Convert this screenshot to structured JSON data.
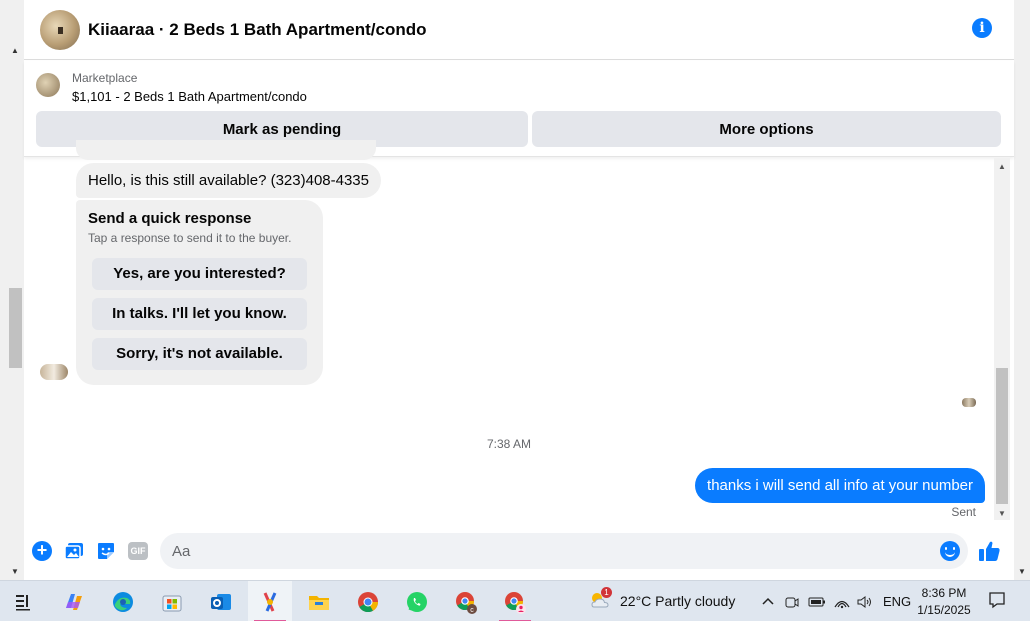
{
  "header": {
    "title": "Kiiaaraa · 2 Beds 1 Bath Apartment/condo"
  },
  "marketplace": {
    "label": "Marketplace",
    "listing": "$1,101 - 2 Beds 1 Bath Apartment/condo",
    "mark_pending_label": "Mark as pending",
    "more_options_label": "More options"
  },
  "messages": {
    "incoming_text": "Hello, is this still available? (323)408-4335",
    "quick_response": {
      "title": "Send a quick response",
      "subtitle": "Tap a response to send it to the buyer.",
      "options": [
        "Yes, are you interested?",
        "In talks. I'll let you know.",
        "Sorry, it's not available."
      ]
    },
    "timestamp": "7:38 AM",
    "outgoing_text": "thanks i will send all info at your number",
    "status": "Sent"
  },
  "composer": {
    "placeholder": "Aa",
    "gif_label": "GIF"
  },
  "taskbar": {
    "weather_badge": "1",
    "weather_text": "22°C  Partly cloudy",
    "language": "ENG",
    "time": "8:36 PM",
    "date": "1/15/2025"
  },
  "colors": {
    "messenger_blue": "#0a7cff",
    "bubble_gray": "#f0f0f0",
    "button_gray": "#e4e6eb"
  }
}
